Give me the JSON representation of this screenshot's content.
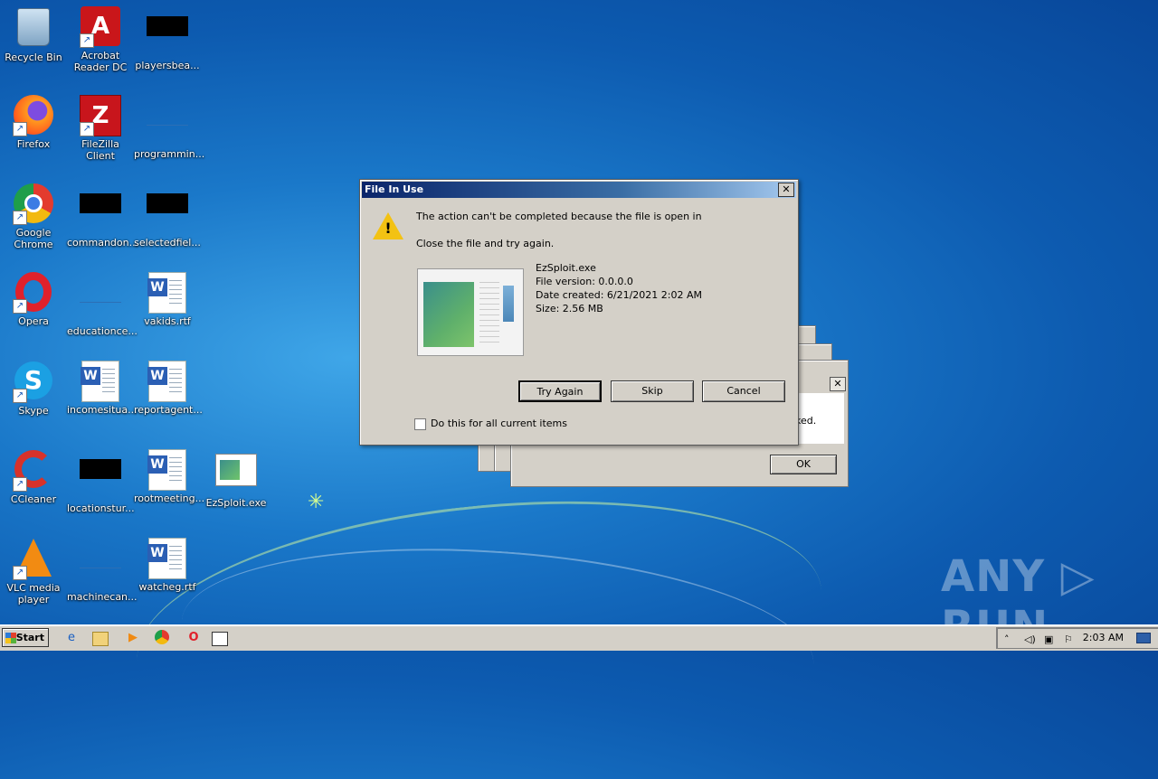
{
  "desktop": {
    "icons": [
      {
        "label": "Recycle Bin"
      },
      {
        "label": "Acrobat Reader DC"
      },
      {
        "label": "playersbea..."
      },
      {
        "label": "Firefox"
      },
      {
        "label": "FileZilla Client"
      },
      {
        "label": "programmin..."
      },
      {
        "label": "Google Chrome"
      },
      {
        "label": "commandon..."
      },
      {
        "label": "selectedfiel..."
      },
      {
        "label": "Opera"
      },
      {
        "label": "educationce..."
      },
      {
        "label": "vakids.rtf"
      },
      {
        "label": "Skype"
      },
      {
        "label": "incomesitua..."
      },
      {
        "label": "reportagent..."
      },
      {
        "label": "CCleaner"
      },
      {
        "label": "locationstur..."
      },
      {
        "label": "rootmeeting..."
      },
      {
        "label": "EzSploit.exe"
      },
      {
        "label": "VLC media player"
      },
      {
        "label": "machinecan..."
      },
      {
        "label": "watcheg.rtf"
      }
    ]
  },
  "dialog": {
    "title": "File In Use",
    "close_glyph": "✕",
    "message_line1": "The action can't be completed because the file is open in",
    "message_line2": "Close the file and try again.",
    "file": {
      "name": "EzSploit.exe",
      "version": "File version: 0.0.0.0",
      "created": "Date created: 6/21/2021 2:02 AM",
      "size": "Size: 2.56 MB"
    },
    "buttons": {
      "try_again": "Try Again",
      "skip": "Skip",
      "cancel": "Cancel"
    },
    "checkbox_label": "Do this for all current items"
  },
  "background_dialog": {
    "partial_text": "ked.",
    "ok_label": "OK"
  },
  "taskbar": {
    "start_label": "Start",
    "clock": "2:03 AM"
  },
  "watermark": "ANY ▷ RUN"
}
